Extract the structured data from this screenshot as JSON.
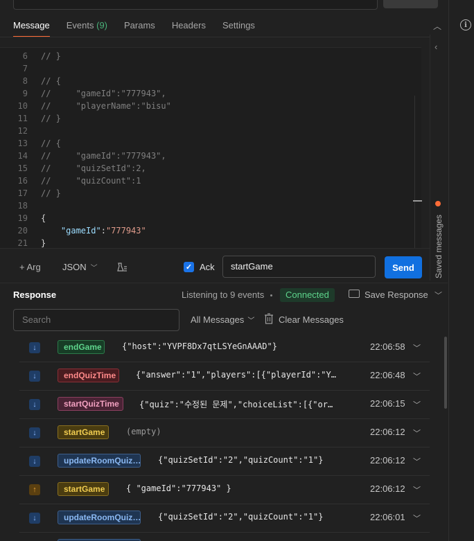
{
  "tabs": [
    {
      "label": "Message",
      "active": true
    },
    {
      "label": "Events",
      "count": "(9)"
    },
    {
      "label": "Params"
    },
    {
      "label": "Headers"
    },
    {
      "label": "Settings"
    }
  ],
  "editor": {
    "lines": [
      {
        "n": "6",
        "text": "// }",
        "kind": "comment"
      },
      {
        "n": "7",
        "text": "",
        "kind": "comment"
      },
      {
        "n": "8",
        "text": "// {",
        "kind": "comment"
      },
      {
        "n": "9",
        "text": "//     \"gameId\":\"777943\",",
        "kind": "comment"
      },
      {
        "n": "10",
        "text": "//     \"playerName\":\"bisu\"",
        "kind": "comment"
      },
      {
        "n": "11",
        "text": "// }",
        "kind": "comment"
      },
      {
        "n": "12",
        "text": "",
        "kind": "comment"
      },
      {
        "n": "13",
        "text": "// {",
        "kind": "comment"
      },
      {
        "n": "14",
        "text": "//     \"gameId\":\"777943\",",
        "kind": "comment"
      },
      {
        "n": "15",
        "text": "//     \"quizSetId\":2,",
        "kind": "comment"
      },
      {
        "n": "16",
        "text": "//     \"quizCount\":1",
        "kind": "comment"
      },
      {
        "n": "17",
        "text": "// }",
        "kind": "comment"
      },
      {
        "n": "18",
        "text": "",
        "kind": "comment"
      },
      {
        "n": "19",
        "text": "{",
        "kind": "punc"
      },
      {
        "n": "20",
        "key": "\"gameId\"",
        "sep": ":",
        "value": "\"777943\"",
        "kind": "kv"
      },
      {
        "n": "21",
        "text": "}",
        "kind": "punc"
      }
    ]
  },
  "toolbar": {
    "arg_label": "+ Arg",
    "format_label": "JSON",
    "ack_label": "Ack",
    "event_name": "startGame",
    "send_label": "Send",
    "ack_checked": true
  },
  "saved_messages_label": "Saved messages",
  "response": {
    "title": "Response",
    "listening": "Listening to 9 events",
    "status": "Connected",
    "save_label": "Save Response",
    "search_placeholder": "Search",
    "filter_label": "All Messages",
    "clear_label": "Clear Messages"
  },
  "messages": [
    {
      "direction": "incoming",
      "event": "endGame",
      "color": "green",
      "payload": "{\"host\":\"YVPF8Dx7qtLSYeGnAAAD\"}",
      "time": "22:06:58"
    },
    {
      "direction": "incoming",
      "event": "endQuizTime",
      "color": "red",
      "payload": "{\"answer\":\"1\",\"players\":[{\"playerId\":\"Y…",
      "time": "22:06:48"
    },
    {
      "direction": "incoming",
      "event": "startQuizTime",
      "color": "pink",
      "payload": "{\"quiz\":\"수정된 문제\",\"choiceList\":[{\"or…",
      "time": "22:06:15"
    },
    {
      "direction": "incoming",
      "event": "startGame",
      "color": "yellow",
      "payload": "(empty)",
      "time": "22:06:12"
    },
    {
      "direction": "incoming",
      "event": "updateRoomQuiz…",
      "color": "blue",
      "payload": "{\"quizSetId\":\"2\",\"quizCount\":\"1\"}",
      "time": "22:06:12"
    },
    {
      "direction": "outgoing",
      "event": "startGame",
      "color": "yellow",
      "payload": "{ \"gameId\":\"777943\" }",
      "time": "22:06:12"
    },
    {
      "direction": "incoming",
      "event": "updateRoomQuiz…",
      "color": "blue",
      "payload": "{\"quizSetId\":\"2\",\"quizCount\":\"1\"}",
      "time": "22:06:01"
    },
    {
      "direction": "incoming",
      "event": "",
      "color": "blue",
      "payload": "",
      "time": ""
    }
  ]
}
